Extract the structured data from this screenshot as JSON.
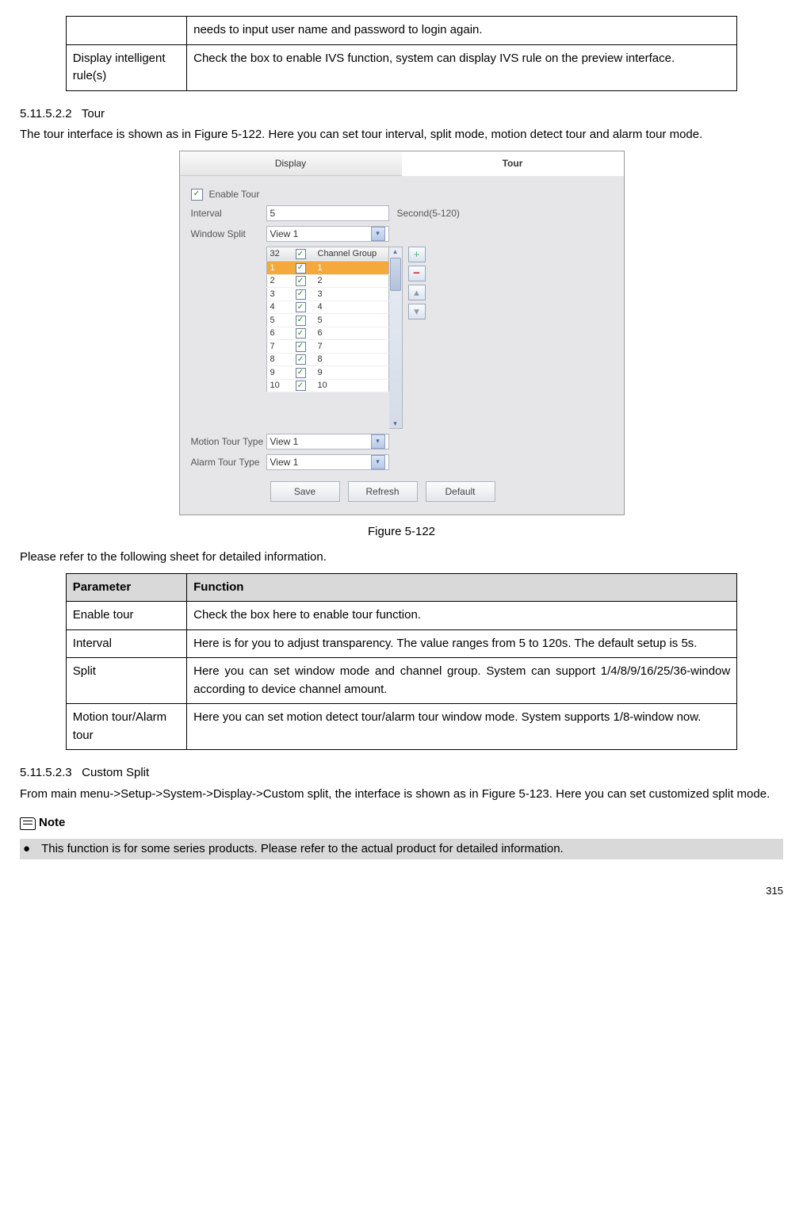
{
  "top_table": {
    "row0_col1": "needs to input user name and password to login again.",
    "row1_col0": "Display intelligent rule(s)",
    "row1_col1": "Check the box to enable IVS function, system can display IVS rule on the preview interface."
  },
  "section1": {
    "num": "5.11.5.2.2",
    "title": "Tour",
    "para": "The tour interface is shown as in Figure 5-122. Here you can set tour interval, split mode, motion detect tour and alarm tour mode."
  },
  "fig_caption": "Figure 5-122",
  "sheet_intro": "Please refer to the following sheet for detailed information.",
  "param_table": {
    "h0": "Parameter",
    "h1": "Function",
    "rows": [
      {
        "p": "Enable tour",
        "f": "Check the box here to enable tour function."
      },
      {
        "p": "Interval",
        "f": "Here is for you to adjust transparency. The value ranges from 5 to 120s. The default setup is 5s."
      },
      {
        "p": "Split",
        "f": "Here you can set window mode and channel group. System can support 1/4/8/9/16/25/36-window according to device channel amount."
      },
      {
        "p": "Motion tour/Alarm tour",
        "f": "Here you can set motion detect tour/alarm tour window mode. System supports 1/8-window now."
      }
    ]
  },
  "section2": {
    "num": "5.11.5.2.3",
    "title": "Custom Split",
    "para": "From main menu->Setup->System->Display->Custom split, the interface is shown as in Figure 5-123. Here you can set customized split mode."
  },
  "note_label": "Note",
  "bullet_text": "This function is for some series products. Please refer to the actual product for detailed information.",
  "page_no": "315",
  "ui": {
    "tabs": {
      "display": "Display",
      "tour": "Tour"
    },
    "enable_tour": "Enable Tour",
    "interval_label": "Interval",
    "interval_value": "5",
    "interval_suffix": "Second(5-120)",
    "window_split_label": "Window Split",
    "view1": "View 1",
    "cg_header_num": "32",
    "cg_header_title": "Channel Group",
    "rows": [
      {
        "n": "1",
        "g": "1",
        "sel": true
      },
      {
        "n": "2",
        "g": "2"
      },
      {
        "n": "3",
        "g": "3"
      },
      {
        "n": "4",
        "g": "4"
      },
      {
        "n": "5",
        "g": "5"
      },
      {
        "n": "6",
        "g": "6"
      },
      {
        "n": "7",
        "g": "7"
      },
      {
        "n": "8",
        "g": "8"
      },
      {
        "n": "9",
        "g": "9"
      },
      {
        "n": "10",
        "g": "10"
      }
    ],
    "motion_label": "Motion Tour Type",
    "alarm_label": "Alarm Tour Type",
    "save": "Save",
    "refresh": "Refresh",
    "default": "Default"
  }
}
